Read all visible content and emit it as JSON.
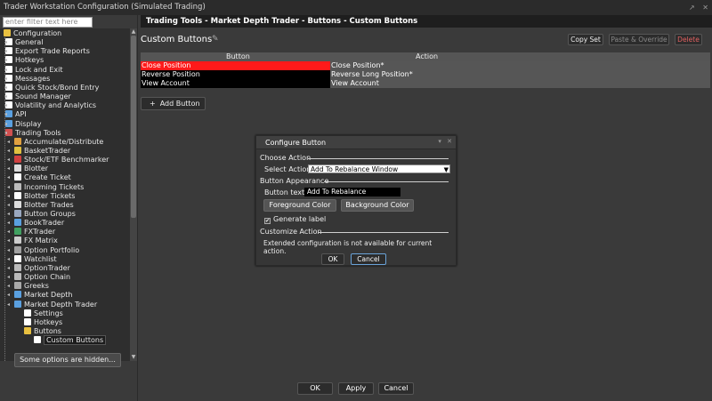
{
  "window": {
    "title": "Trader Workstation Configuration (Simulated Trading)",
    "controls": [
      "↗",
      "✕"
    ]
  },
  "filter": {
    "placeholder": "enter filter text here"
  },
  "tree": {
    "items": [
      {
        "label": "Configuration",
        "level": 0,
        "icon": "folder-icon",
        "color": "#e8c040"
      },
      {
        "label": "General",
        "level": 1,
        "icon": "page-icon",
        "color": "#ffffff"
      },
      {
        "label": "Export Trade Reports",
        "level": 1,
        "icon": "page-icon",
        "color": "#ffffff"
      },
      {
        "label": "Hotkeys",
        "level": 1,
        "icon": "page-icon",
        "color": "#ffffff"
      },
      {
        "label": "Lock and Exit",
        "level": 1,
        "icon": "page-icon",
        "color": "#ffffff"
      },
      {
        "label": "Messages",
        "level": 1,
        "icon": "page-icon",
        "color": "#ffffff"
      },
      {
        "label": "Quick Stock/Bond Entry",
        "level": 1,
        "icon": "page-icon",
        "color": "#ffffff"
      },
      {
        "label": "Sound Manager",
        "level": 1,
        "icon": "page-icon",
        "color": "#ffffff"
      },
      {
        "label": "Volatility and Analytics",
        "level": 1,
        "icon": "page-icon",
        "color": "#ffffff"
      },
      {
        "label": "API",
        "level": 1,
        "icon": "api-icon",
        "color": "#5aa0e0"
      },
      {
        "label": "Display",
        "level": 1,
        "icon": "display-icon",
        "color": "#5aa0e0"
      },
      {
        "label": "Trading Tools",
        "level": 1,
        "icon": "trading-tools-icon",
        "color": "#d05050"
      },
      {
        "label": "Accumulate/Distribute",
        "level": 2,
        "icon": "accumulate-icon",
        "color": "#e0a040"
      },
      {
        "label": "BasketTrader",
        "level": 2,
        "icon": "basket-icon",
        "color": "#e0c040"
      },
      {
        "label": "Stock/ETF Benchmarker",
        "level": 2,
        "icon": "benchmark-icon",
        "color": "#d04040"
      },
      {
        "label": "Blotter",
        "level": 2,
        "icon": "blotter-icon",
        "color": "#dddddd"
      },
      {
        "label": "Create Ticket",
        "level": 2,
        "icon": "ticket-icon",
        "color": "#ffffff"
      },
      {
        "label": "Incoming Tickets",
        "level": 2,
        "icon": "incoming-icon",
        "color": "#bbbbbb"
      },
      {
        "label": "Blotter Tickets",
        "level": 2,
        "icon": "blotter-tickets-icon",
        "color": "#ffffff"
      },
      {
        "label": "Blotter Trades",
        "level": 2,
        "icon": "blotter-trades-icon",
        "color": "#dddddd"
      },
      {
        "label": "Button Groups",
        "level": 2,
        "icon": "grid-icon",
        "color": "#9aa8c0"
      },
      {
        "label": "BookTrader",
        "level": 2,
        "icon": "booktrader-icon",
        "color": "#5aa0e0"
      },
      {
        "label": "FXTrader",
        "level": 2,
        "icon": "fx-icon",
        "color": "#40a060"
      },
      {
        "label": "FX Matrix",
        "level": 2,
        "icon": "fx-matrix-icon",
        "color": "#cccccc"
      },
      {
        "label": "Option Portfolio",
        "level": 2,
        "icon": "option-portfolio-icon",
        "color": "#a0a0a0"
      },
      {
        "label": "Watchlist",
        "level": 2,
        "icon": "watchlist-icon",
        "color": "#ffffff"
      },
      {
        "label": "OptionTrader",
        "level": 2,
        "icon": "optiontrader-icon",
        "color": "#bbbbbb"
      },
      {
        "label": "Option Chain",
        "level": 2,
        "icon": "option-chain-icon",
        "color": "#bbbbbb"
      },
      {
        "label": "Greeks",
        "level": 2,
        "icon": "greeks-icon",
        "color": "#aaaaaa"
      },
      {
        "label": "Market Depth",
        "level": 2,
        "icon": "market-depth-icon",
        "color": "#5aa0e0"
      },
      {
        "label": "Market Depth Trader",
        "level": 2,
        "icon": "market-depth-trader-icon",
        "color": "#5aa0e0"
      },
      {
        "label": "Settings",
        "level": 3,
        "icon": "page-icon",
        "color": "#ffffff"
      },
      {
        "label": "Hotkeys",
        "level": 3,
        "icon": "page-icon",
        "color": "#ffffff"
      },
      {
        "label": "Buttons",
        "level": 3,
        "icon": "folder-icon",
        "color": "#e8c040"
      },
      {
        "label": "Custom Buttons",
        "level": 4,
        "icon": "custom-buttons-icon",
        "color": "#ffffff",
        "selected": true
      }
    ]
  },
  "hidden_button": "Some options are hidden...",
  "breadcrumb": "Trading Tools - Market Depth Trader - Buttons - Custom Buttons",
  "panel": {
    "title": "Custom Buttons",
    "copy_set": "Copy Set",
    "paste_override": "Paste & Override",
    "delete": "Delete",
    "col_button": "Button",
    "col_action": "Action",
    "rows": [
      {
        "button": "Close Position",
        "action": "Close Position*"
      },
      {
        "button": "Reverse Position",
        "action": "Reverse Long Position*"
      },
      {
        "button": "View Account",
        "action": "View Account"
      }
    ],
    "add_button": "Add Button"
  },
  "dialog": {
    "title": "Configure Button",
    "controls": [
      "▾",
      "✕"
    ],
    "choose_action": "Choose Action",
    "select_action_label": "Select Action",
    "select_action_value": "Add To Rebalance Window",
    "button_appearance": "Button Appearance",
    "button_text_label": "Button text",
    "button_text_value": "Add To Rebalance",
    "foreground_color": "Foreground Color",
    "background_color": "Background Color",
    "generate_label": "Generate label",
    "generate_checked": true,
    "customize_action": "Customize Action",
    "ext_message": "Extended configuration is not available for current action.",
    "ok": "OK",
    "cancel": "Cancel"
  },
  "footer": {
    "ok": "OK",
    "apply": "Apply",
    "cancel": "Cancel"
  }
}
